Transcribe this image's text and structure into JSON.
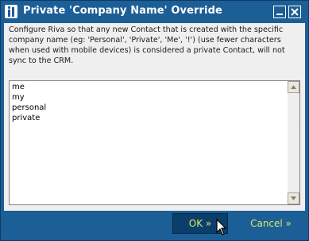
{
  "window": {
    "title": "Private 'Company Name' Override"
  },
  "description": "Configure Riva so that any new Contact that is created with the specific company name (eg: 'Personal', 'Private', 'Me', '!') (use fewer characters when used with mobile devices) is considered a private Contact, will not sync to the CRM.",
  "list": {
    "items": [
      "me",
      "my",
      "personal",
      "private"
    ]
  },
  "buttons": {
    "ok_label": "OK »",
    "cancel_label": "Cancel »"
  },
  "colors": {
    "frame": "#1c5e96",
    "content_bg": "#efefef",
    "button_text": "#dbe86a",
    "ok_bg": "#0b3f6b"
  },
  "icons": {
    "app": "riva-app-icon",
    "minimize": "minimize-icon",
    "close": "close-icon",
    "scroll_up": "scroll-up-arrow-icon",
    "scroll_down": "scroll-down-arrow-icon",
    "cursor": "mouse-pointer-icon"
  }
}
